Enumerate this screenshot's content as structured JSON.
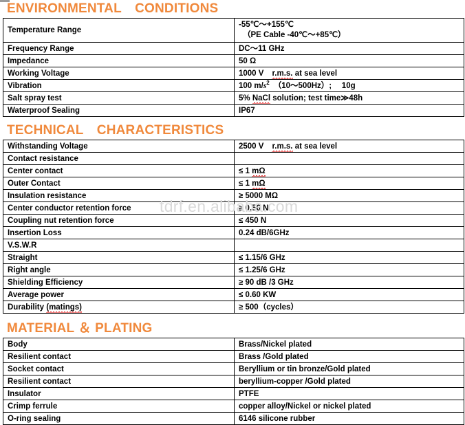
{
  "document": {
    "watermark": "tdrf.en.alibaba.com",
    "accent_color": "#f0893c",
    "border_color": "#000000",
    "watermark_color": "#d9d9d9"
  },
  "sections": [
    {
      "id": "environmental",
      "title": "ENVIRONMENTAL CONDITIONS",
      "rows": [
        {
          "label": "Temperature Range",
          "value_line1": "-55℃～+155℃",
          "value_line2": "（PE Cable -40℃～+85℃）",
          "tall": true
        },
        {
          "label": "Frequency Range",
          "value": "DC～11 GHz"
        },
        {
          "label": "Impedance",
          "value": "50 Ω"
        },
        {
          "label": "Working Voltage",
          "value_prefix": "1000 V",
          "value_squiggle": "r.m.s.",
          "value_suffix": " at sea level"
        },
        {
          "label": "Vibration",
          "value_prefix": "100 m/",
          "value_italic": "s",
          "value_sup": "2",
          "value_suffix": "（10～500Hz）;  10g"
        },
        {
          "label": "Salt spray test",
          "value_prefix": "5% ",
          "value_squiggle": "NaCl",
          "value_suffix": " solution; test time≫48h"
        },
        {
          "label": "Waterproof Sealing",
          "value": "IP67"
        }
      ]
    },
    {
      "id": "technical",
      "title": "TECHNICAL CHARACTERISTICS",
      "rows": [
        {
          "label": "Withstanding Voltage",
          "value_prefix": "2500 V",
          "value_squiggle": "r.m.s.",
          "value_suffix": " at sea level"
        },
        {
          "label": "Contact resistance",
          "value": ""
        },
        {
          "label": "Center contact",
          "value_prefix": "≤ 1 ",
          "value_squiggle": "mΩ",
          "value_suffix": ""
        },
        {
          "label": "Outer Contact",
          "value_prefix": "≤ 1 ",
          "value_squiggle": "mΩ",
          "value_suffix": ""
        },
        {
          "label": "Insulation resistance",
          "value": "≥ 5000 MΩ"
        },
        {
          "label": "Center conductor retention force",
          "value": "≥ 0.56 N"
        },
        {
          "label": "Coupling nut retention force",
          "value": "≤ 450 N"
        },
        {
          "label": "Insertion Loss",
          "value": "0.24 dB/6GHz"
        },
        {
          "label": "V.S.W.R",
          "value": ""
        },
        {
          "label": "Straight",
          "value": "≤ 1.15/6 GHz"
        },
        {
          "label": "Right angle",
          "value": "≤ 1.25/6 GHz"
        },
        {
          "label": "Shielding Efficiency",
          "value": "≥ 90 dB /3 GHz"
        },
        {
          "label": "Average power",
          "value": "≤ 0.60 KW"
        },
        {
          "label_prefix": "Durability ",
          "label_squiggle": "(matings)",
          "value": "≥ 500（cycles）"
        }
      ]
    },
    {
      "id": "material",
      "title": "MATERIAL ＆ PLATING",
      "rows": [
        {
          "label": "Body",
          "value": "Brass/Nickel plated"
        },
        {
          "label": "Resilient contact",
          "value": "Brass /Gold plated"
        },
        {
          "label": "Socket contact",
          "value": "Beryllium or tin bronze/Gold plated"
        },
        {
          "label": "Resilient contact",
          "value": "beryllium-copper /Gold plated"
        },
        {
          "label": "Insulator",
          "value": "PTFE"
        },
        {
          "label": "Crimp ferrule",
          "value": "copper alloy/Nickel or nickel plated"
        },
        {
          "label": "O-ring sealing",
          "value": "6146 silicone rubber"
        }
      ]
    }
  ]
}
